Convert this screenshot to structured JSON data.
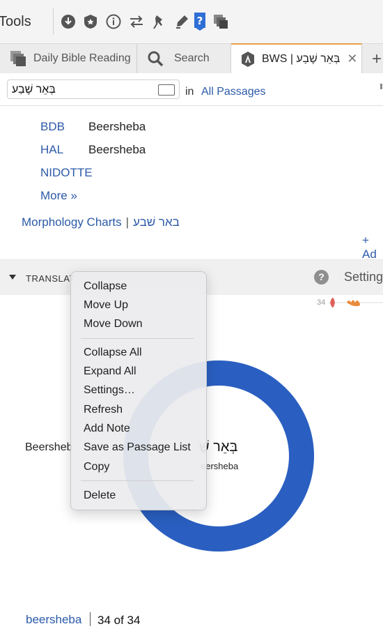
{
  "toolbar": {
    "tools_label": "Tools",
    "icons": [
      "download-icon",
      "shield-icon",
      "info-icon",
      "sync-arrows-icon",
      "pin-icon",
      "highlighter-icon",
      "help-icon",
      "layers-icon"
    ]
  },
  "tabs": [
    {
      "label": "Daily Bible Reading",
      "icon": "reading-plan-icon"
    },
    {
      "label": "Search",
      "icon": "magnifier-icon"
    },
    {
      "label": "BWS | בְּאֵר שֶׁבַע",
      "icon": "bws-icon",
      "active": true
    }
  ],
  "search": {
    "query": "בְּאֵר שֶׁבַע",
    "in_label": "in",
    "scope": "All Passages"
  },
  "lexicons": [
    {
      "name": "BDB",
      "gloss": "Beersheba"
    },
    {
      "name": "HAL",
      "gloss": "Beersheba"
    },
    {
      "name": "NIDOTTE",
      "gloss": ""
    }
  ],
  "more_link": "More »",
  "morphology": {
    "label": "Morphology Charts",
    "sep": "|",
    "word": "באר שׁבע"
  },
  "add_link": "+ Ad",
  "section": {
    "title": "TRANSLAT",
    "help": "?",
    "settings": "Setting",
    "spark_count": "34"
  },
  "chart_data": {
    "type": "pie",
    "categories": [
      "Beersheba"
    ],
    "values": [
      34
    ],
    "center_label": "בְּאֵר שֶׁ",
    "center_sub": "eersheba",
    "side_label": "Beersheb",
    "colors": [
      "#2a5fc1"
    ]
  },
  "footer": {
    "link": "beersheba",
    "sep": "|",
    "count": "34 of 34"
  },
  "context_menu": {
    "items": [
      "Collapse",
      "Move Up",
      "Move Down",
      "Collapse All",
      "Expand All",
      "Settings…",
      "Refresh",
      "Add Note",
      "Save as Passage List",
      "Copy",
      "Delete"
    ]
  },
  "colors": {
    "link": "#2b5aa8",
    "accent_tab": "#e9a04a",
    "donut": "#2a5fc1"
  }
}
